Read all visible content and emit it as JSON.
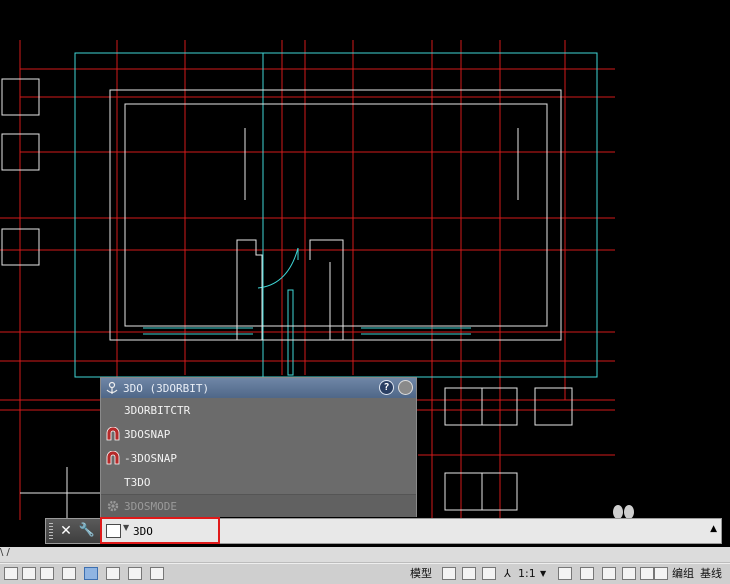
{
  "autocomplete": {
    "header": "3DO (3DORBIT)",
    "help_glyph": "?",
    "items": [
      {
        "label": "3DORBITCTR",
        "icon": "none"
      },
      {
        "label": "3DOSNAP",
        "icon": "magnet-icon"
      },
      {
        "label": "-3DOSNAP",
        "icon": "magnet-icon"
      },
      {
        "label": "T3DO",
        "icon": "none"
      },
      {
        "label": "3DOSMODE",
        "icon": "gear-icon"
      }
    ]
  },
  "command_line": {
    "value": "3DO",
    "close_glyph": "✕",
    "tools_glyph": "🔧",
    "scroll_glyph": "▲"
  },
  "status_bar": {
    "model_label": "模型",
    "scale_label": "1:1",
    "group_label": "编组",
    "baseline_label": "基线",
    "tab_slash": "\\ /"
  },
  "colors": {
    "grid_red": "#d21a1a",
    "cyan": "#3fd6d6",
    "white_lines": "#e6e6e6",
    "highlight_red": "#e01a1a"
  }
}
